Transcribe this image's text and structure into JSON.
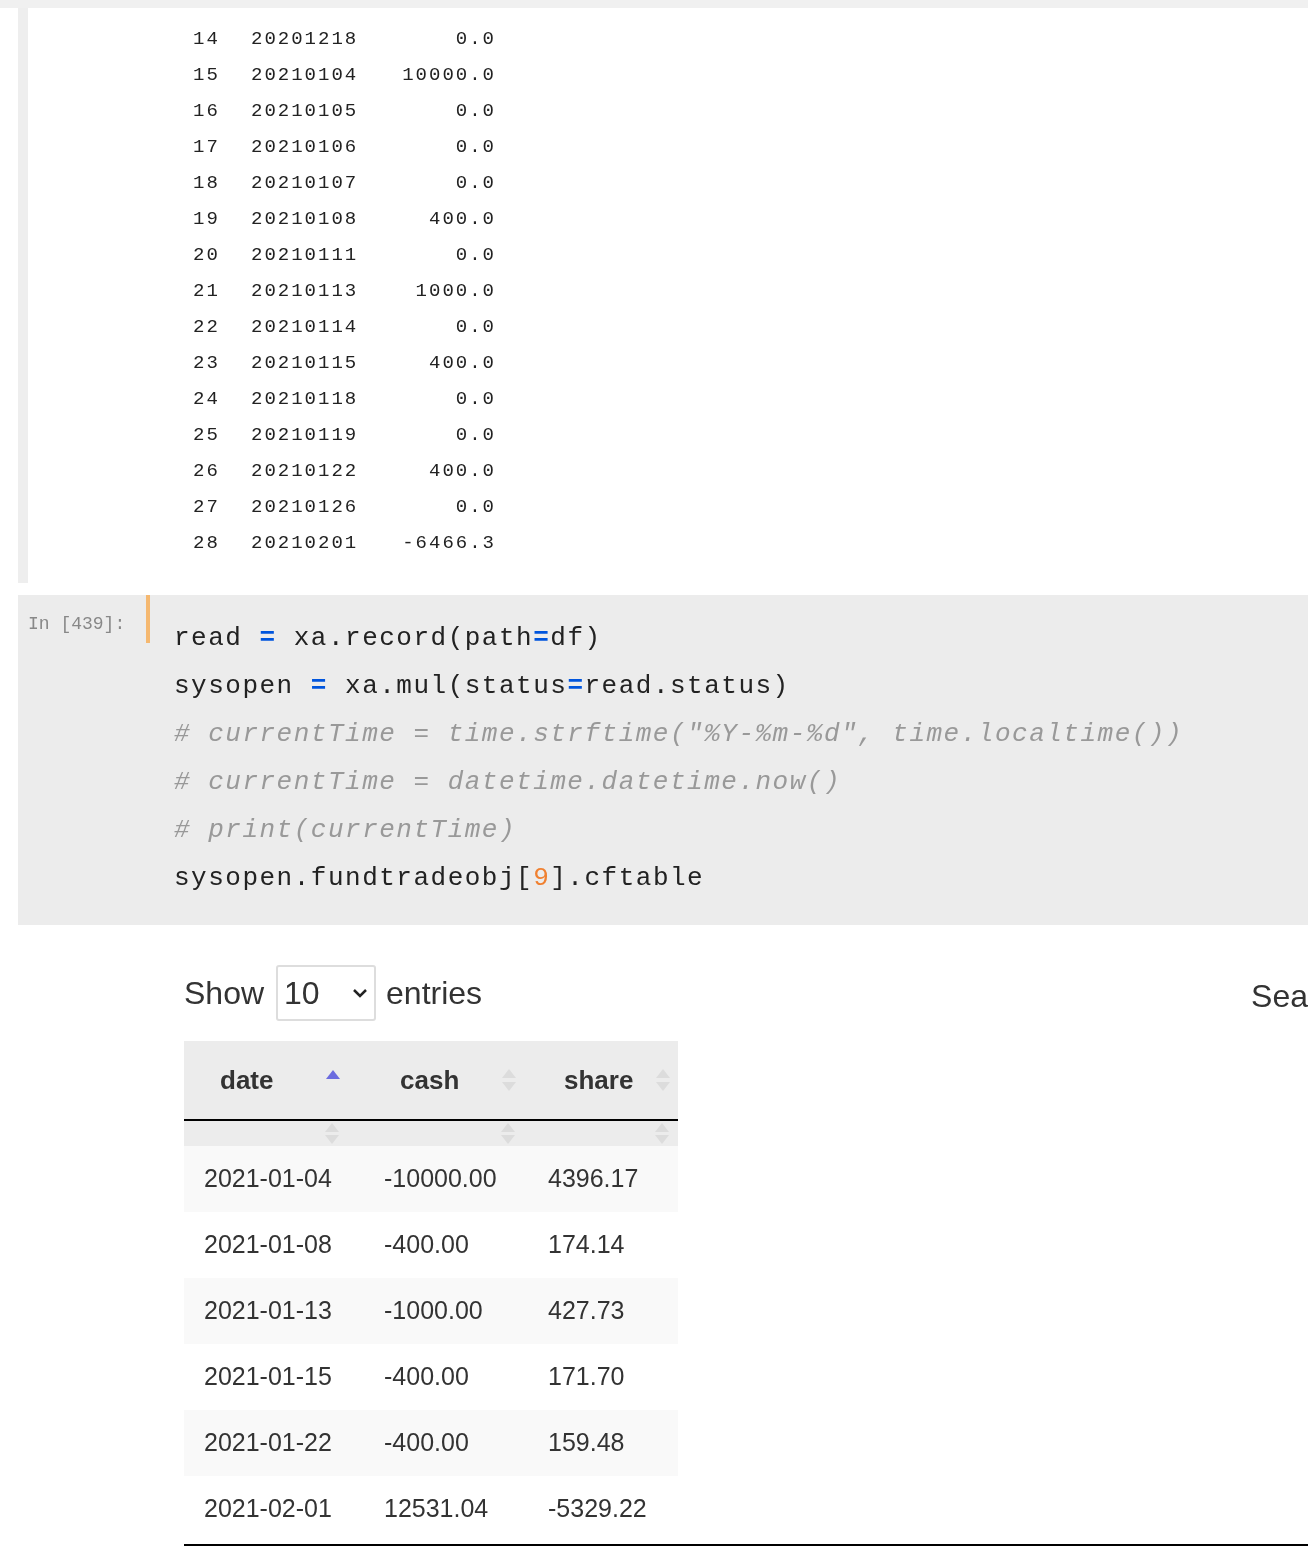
{
  "output_rows": [
    [
      "14",
      "20201218",
      "0.0"
    ],
    [
      "15",
      "20210104",
      "10000.0"
    ],
    [
      "16",
      "20210105",
      "0.0"
    ],
    [
      "17",
      "20210106",
      "0.0"
    ],
    [
      "18",
      "20210107",
      "0.0"
    ],
    [
      "19",
      "20210108",
      "400.0"
    ],
    [
      "20",
      "20210111",
      "0.0"
    ],
    [
      "21",
      "20210113",
      "1000.0"
    ],
    [
      "22",
      "20210114",
      "0.0"
    ],
    [
      "23",
      "20210115",
      "400.0"
    ],
    [
      "24",
      "20210118",
      "0.0"
    ],
    [
      "25",
      "20210119",
      "0.0"
    ],
    [
      "26",
      "20210122",
      "400.0"
    ],
    [
      "27",
      "20210126",
      "0.0"
    ],
    [
      "28",
      "20210201",
      "-6466.3"
    ]
  ],
  "code_cell": {
    "prompt": "In [439]:",
    "lines": [
      {
        "tokens": [
          {
            "kind": "name",
            "text": "read "
          },
          {
            "kind": "operator",
            "text": "="
          },
          {
            "kind": "name",
            "text": " xa.record(path"
          },
          {
            "kind": "operator",
            "text": "="
          },
          {
            "kind": "name",
            "text": "df)"
          }
        ]
      },
      {
        "tokens": [
          {
            "kind": "name",
            "text": "sysopen "
          },
          {
            "kind": "operator",
            "text": "="
          },
          {
            "kind": "name",
            "text": " xa.mul(status"
          },
          {
            "kind": "operator",
            "text": "="
          },
          {
            "kind": "name",
            "text": "read.status)"
          }
        ]
      },
      {
        "tokens": [
          {
            "kind": "comment",
            "text": "# currentTime = time.strftime(\"%Y-%m-%d\", time.localtime())"
          }
        ]
      },
      {
        "tokens": [
          {
            "kind": "comment",
            "text": "# currentTime = datetime.datetime.now()"
          }
        ]
      },
      {
        "tokens": [
          {
            "kind": "comment",
            "text": "# print(currentTime)"
          }
        ]
      },
      {
        "tokens": [
          {
            "kind": "name",
            "text": "sysopen.fundtradeobj["
          },
          {
            "kind": "number",
            "text": "9"
          },
          {
            "kind": "name",
            "text": "].cftable"
          }
        ]
      }
    ]
  },
  "datatable": {
    "show_label": "Show",
    "page_size": "10",
    "entries_label": "entries",
    "search_label": "Sea",
    "columns": [
      {
        "label": "date",
        "sorted": true
      },
      {
        "label": "cash",
        "sorted": false
      },
      {
        "label": "share",
        "sorted": false
      }
    ],
    "rows": [
      [
        "2021-01-04",
        "-10000.00",
        "4396.17"
      ],
      [
        "2021-01-08",
        "-400.00",
        "174.14"
      ],
      [
        "2021-01-13",
        "-1000.00",
        "427.73"
      ],
      [
        "2021-01-15",
        "-400.00",
        "171.70"
      ],
      [
        "2021-01-22",
        "-400.00",
        "159.48"
      ],
      [
        "2021-02-01",
        "12531.04",
        "-5329.22"
      ]
    ]
  }
}
